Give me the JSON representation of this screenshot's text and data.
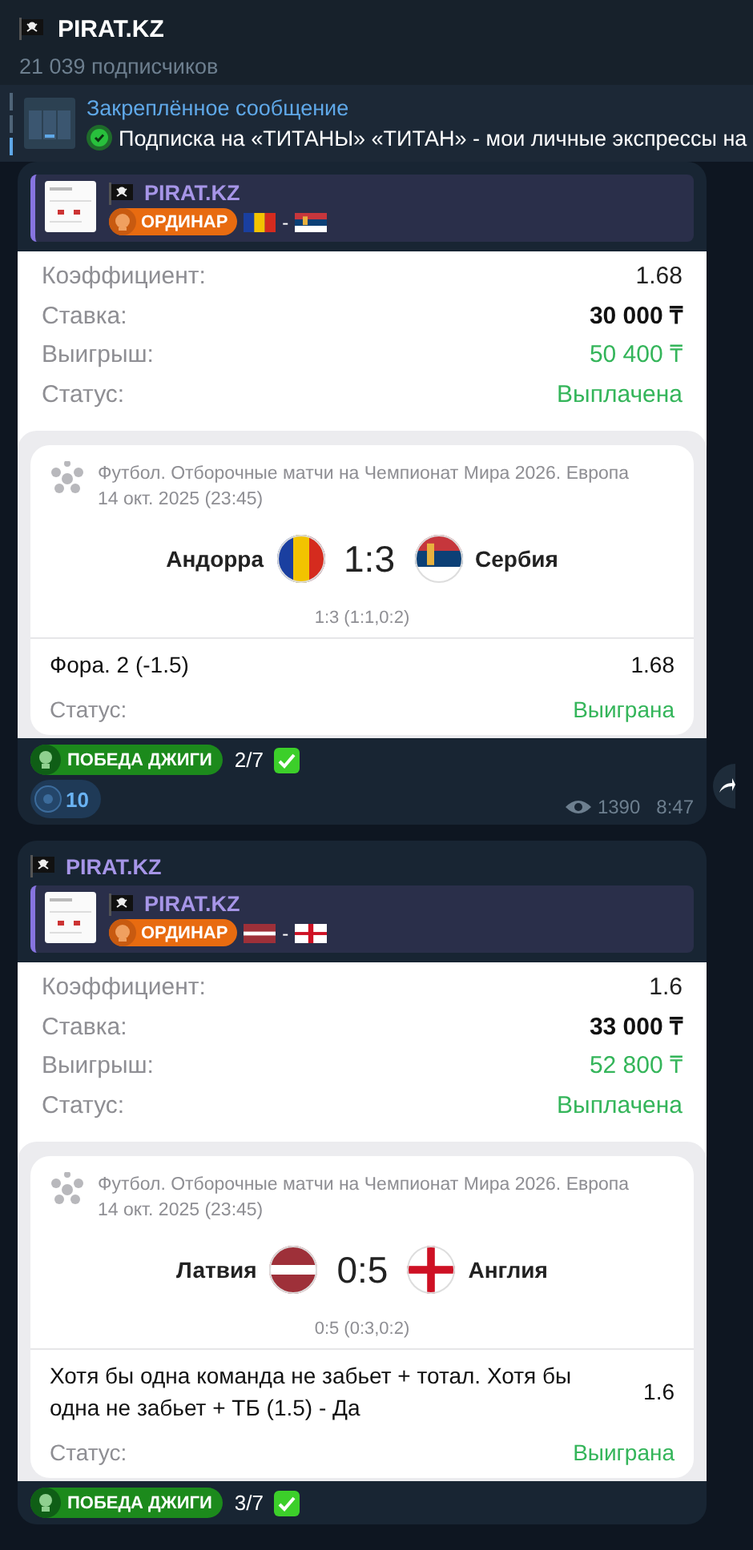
{
  "channel": {
    "title": "PIRAT.KZ",
    "subscribers": "21 039 подписчиков"
  },
  "pinned": {
    "label": "Закреплённое сообщение",
    "text": "Подписка на «ТИТАНЫ»  «ТИТАН» - мои личные экспрессы на"
  },
  "posts": [
    {
      "reply": {
        "author": "PIRAT.KZ",
        "badge": "ОРДИНАР",
        "separator": "-"
      },
      "summary": [
        {
          "label": "Коэффициент:",
          "value": "1.68",
          "kind": "plain"
        },
        {
          "label": "Ставка:",
          "value": "30 000 ₸",
          "kind": "plain"
        },
        {
          "label": "Выигрыш:",
          "value": "50 400 ₸",
          "kind": "accent"
        },
        {
          "label": "Статус:",
          "value": "Выплачена",
          "kind": "accent"
        }
      ],
      "match": {
        "league": "Футбол. Отборочные матчи на Чемпионат Мира 2026. Европа",
        "date": "14 окт. 2025 (23:45)",
        "home": "Андорра",
        "score": "1:3",
        "away": "Сербия",
        "periods": "1:3 (1:1,0:2)",
        "bet": "Фора. 2 (-1.5)",
        "odds": "1.68",
        "status_label": "Статус:",
        "status": "Выиграна"
      },
      "tag": {
        "badge": "ПОБЕДА ДЖИГИ",
        "count": "2/7"
      },
      "reactions": [
        {
          "count": "10"
        }
      ],
      "views": "1390",
      "time": "8:47"
    },
    {
      "author": "PIRAT.KZ",
      "reply": {
        "author": "PIRAT.KZ",
        "badge": "ОРДИНАР",
        "separator": "-"
      },
      "summary": [
        {
          "label": "Коэффициент:",
          "value": "1.6",
          "kind": "plain"
        },
        {
          "label": "Ставка:",
          "value": "33 000 ₸",
          "kind": "plain"
        },
        {
          "label": "Выигрыш:",
          "value": "52 800 ₸",
          "kind": "accent"
        },
        {
          "label": "Статус:",
          "value": "Выплачена",
          "kind": "accent"
        }
      ],
      "match": {
        "league": "Футбол. Отборочные матчи на Чемпионат Мира 2026. Европа",
        "date": "14 окт. 2025 (23:45)",
        "home": "Латвия",
        "score": "0:5",
        "away": "Англия",
        "periods": "0:5 (0:3,0:2)",
        "bet": "Хотя бы одна команда не забьет + тотал. Хотя бы одна не забьет + ТБ (1.5) - Да",
        "odds": "1.6",
        "status_label": "Статус:",
        "status": "Выиграна"
      },
      "tag": {
        "badge": "ПОБЕДА ДЖИГИ",
        "count": "3/7"
      }
    }
  ]
}
